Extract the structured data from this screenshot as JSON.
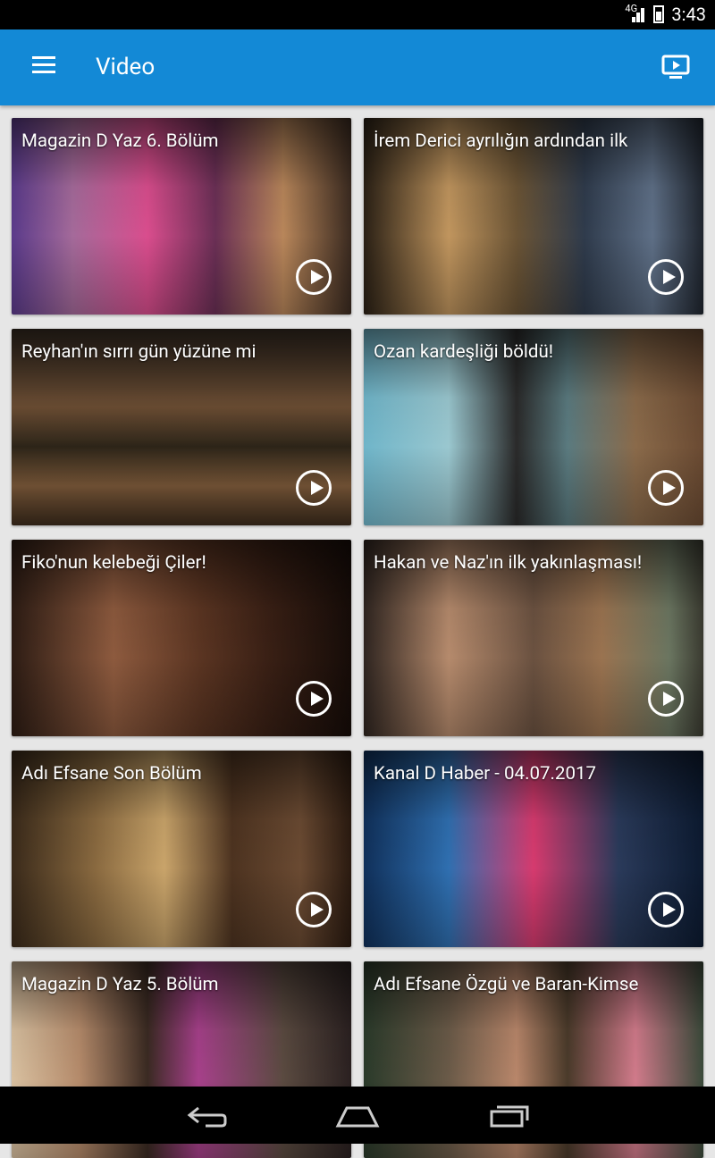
{
  "status": {
    "network": "4G",
    "time": "3:43"
  },
  "app_bar": {
    "title": "Video"
  },
  "videos": [
    {
      "title": "Magazin D Yaz 6. Bölüm",
      "bg": "linear-gradient(90deg,#5a3a8a 0%,#a46a9a 18%,#d94d8d 40%,#6a2f55 60%,#b8865a 80%,#3a2a20 100%)"
    },
    {
      "title": "İrem Derici ayrılığın ardından ilk",
      "bg": "linear-gradient(90deg,#2a2015 0%,#c0955e 25%,#6b5435 45%,#2f3b4c 65%,#5e6f86 85%,#1f252e 100%)"
    },
    {
      "title": "Reyhan'ın sırrı gün yüzüne mi",
      "bg": "linear-gradient(180deg,#3a2e24 0%,#6b4d33 40%,#2c2418 60%,#7d5a3a 80%,#3d2c1d 100%)"
    },
    {
      "title": "Ozan kardeşliği böldü!",
      "bg": "linear-gradient(90deg,#6fb5c9 0%,#9ac7cf 25%,#2a2a2a 45%,#5a7a7f 60%,#8a6a4a 80%,#6a4a32 100%)"
    },
    {
      "title": "Fiko'nun kelebeği Çiler!",
      "bg": "linear-gradient(90deg,#2d1c14 0%,#8d5a3e 30%,#5b3522 55%,#3a2015 75%,#160c08 100%)"
    },
    {
      "title": "Hakan ve Naz'ın ilk yakınlaşması!",
      "bg": "linear-gradient(90deg,#2f2520 0%,#b58a6c 25%,#6a5140 50%,#9a7350 70%,#6a7560 90%,#3a3a30 100%)"
    },
    {
      "title": "Adı Efsane Son Bölüm",
      "bg": "linear-gradient(90deg,#3a2a1a 0%,#8a6a40 25%,#c9a46a 45%,#4d3320 65%,#6a4a32 85%,#2a1a10 100%)"
    },
    {
      "title": "Kanal D Haber - 04.07.2017",
      "bg": "linear-gradient(90deg,#10305a 0%,#2f6fb0 25%,#d63a6e 50%,#2a3a5a 75%,#0c1a30 100%)"
    },
    {
      "title": "Magazin D Yaz 5. Bölüm",
      "bg": "linear-gradient(90deg,#d8c0a0 0%,#b48a6a 20%,#3a2a22 40%,#a6408a 55%,#5a4a40 80%,#2a2020 100%)"
    },
    {
      "title": "Adı Efsane Özgü ve Baran-Kimse",
      "bg": "linear-gradient(90deg,#2a3a2a 0%,#6a5a48 25%,#b8866a 45%,#4a3a2a 60%,#d07a8a 80%,#3a4a3a 100%)"
    }
  ]
}
